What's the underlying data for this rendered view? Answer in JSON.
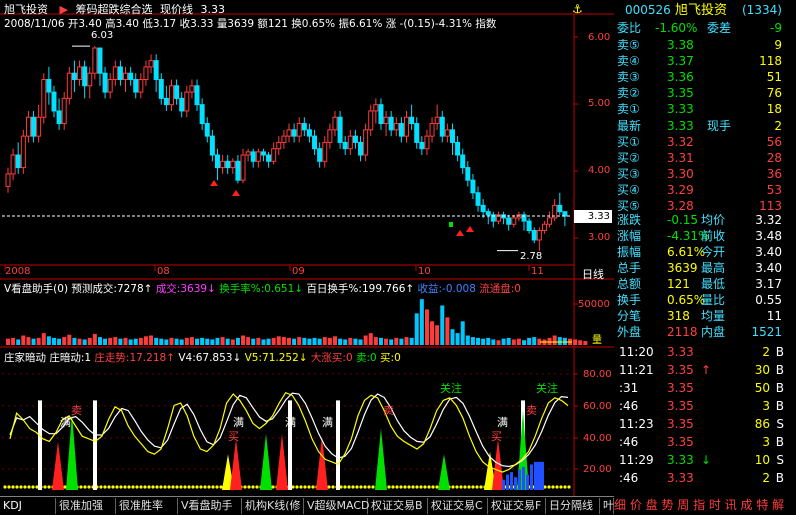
{
  "chart_header": {
    "title": "旭飞投资",
    "indicator": "筹码超跌综合选",
    "price_label": "现价线",
    "price_value": "3.33",
    "info_date": "2008/11/06",
    "info_open": "开3.40",
    "info_high": "高3.40",
    "info_low": "低3.17",
    "info_close": "收3.33",
    "info_vol": "量3639",
    "info_amount": "额121",
    "info_turnover": "换0.65%",
    "info_amp": "振6.61%",
    "info_chg": "涨 -(0.15)-4.31%",
    "info_mode": "指数"
  },
  "price_axis": [
    "6.00",
    "5.00",
    "4.00",
    "3.00"
  ],
  "price_marks": {
    "high_label": "6.03",
    "low_label": "2.78",
    "current_tag": "3.33"
  },
  "time_axis": [
    "2008",
    "08",
    "09",
    "10",
    "11"
  ],
  "time_axis_mode": "日线",
  "volume_header": {
    "name": "V看盘助手(0)",
    "predict": "预测成交:7278↑",
    "turnover_label": "成交:3639↓",
    "rate_label": "换手率%:0.651↓",
    "hundred_day": "百日换手%:199.766↑",
    "income": "收益:-0.008",
    "float": "流通盘:0"
  },
  "volume_axis": [
    "50000"
  ],
  "volume_axis_label": "量",
  "indicator_header": {
    "name": "庄家暗动",
    "f1": "庄暗动:1",
    "f2": "庄走势:17.218↑",
    "f3": "V4:67.853↓",
    "f4": "V5:71.252↓",
    "f5": "大涨买:0",
    "f6": "卖:0",
    "f7": "买:0"
  },
  "indicator_axis": [
    "80.00",
    "60.00",
    "40.00",
    "20.00"
  ],
  "indicator_labels": {
    "focus1": "关注",
    "focus2": "关注",
    "full": "满",
    "buy": "买",
    "sell": "卖"
  },
  "colors": {
    "up": "#ff3c3c",
    "down": "#00e0ff",
    "grid": "#900000",
    "bg": "#000000",
    "axis": "#c00000"
  },
  "chart_data": {
    "type": "candlestick",
    "price_ylim": [
      2.6,
      6.35
    ],
    "candles": [
      [
        3.8,
        4.0,
        4.1,
        3.7
      ],
      [
        4.0,
        4.3,
        4.4,
        3.9
      ],
      [
        4.3,
        4.1,
        4.5,
        4.0
      ],
      [
        4.1,
        4.6,
        4.7,
        4.0
      ],
      [
        4.6,
        4.9,
        5.0,
        4.5
      ],
      [
        4.9,
        4.6,
        5.0,
        4.5
      ],
      [
        4.6,
        4.9,
        5.1,
        4.5
      ],
      [
        4.9,
        5.5,
        5.6,
        4.8
      ],
      [
        5.5,
        5.3,
        5.7,
        5.1
      ],
      [
        5.3,
        5.0,
        5.4,
        4.9
      ],
      [
        5.0,
        4.8,
        5.2,
        4.7
      ],
      [
        4.8,
        5.2,
        5.3,
        4.7
      ],
      [
        5.2,
        5.6,
        5.7,
        5.1
      ],
      [
        5.6,
        5.5,
        5.8,
        5.3
      ],
      [
        5.5,
        5.7,
        5.8,
        5.4
      ],
      [
        5.7,
        5.4,
        5.8,
        5.2
      ],
      [
        5.4,
        5.6,
        5.7,
        5.2
      ],
      [
        5.6,
        6.0,
        6.03,
        5.5
      ],
      [
        6.0,
        5.6,
        6.0,
        5.4
      ],
      [
        5.6,
        5.3,
        5.7,
        5.2
      ],
      [
        5.3,
        5.5,
        5.6,
        5.2
      ],
      [
        5.5,
        5.7,
        5.8,
        5.4
      ],
      [
        5.7,
        5.5,
        5.8,
        5.4
      ],
      [
        5.5,
        5.6,
        5.7,
        5.3
      ],
      [
        5.6,
        5.5,
        5.7,
        5.4
      ],
      [
        5.5,
        5.3,
        5.6,
        5.2
      ],
      [
        5.3,
        5.5,
        5.6,
        5.2
      ],
      [
        5.5,
        5.7,
        5.8,
        5.4
      ],
      [
        5.7,
        5.8,
        5.9,
        5.6
      ],
      [
        5.8,
        5.5,
        5.9,
        5.3
      ],
      [
        5.5,
        5.2,
        5.6,
        5.1
      ],
      [
        5.2,
        5.1,
        5.4,
        5.0
      ],
      [
        5.1,
        5.4,
        5.5,
        5.0
      ],
      [
        5.4,
        5.2,
        5.5,
        5.1
      ],
      [
        5.2,
        5.0,
        5.3,
        4.9
      ],
      [
        5.0,
        5.3,
        5.4,
        4.9
      ],
      [
        5.3,
        5.4,
        5.5,
        5.2
      ],
      [
        5.4,
        5.1,
        5.5,
        5.0
      ],
      [
        5.1,
        4.8,
        5.2,
        4.7
      ],
      [
        4.8,
        4.6,
        4.9,
        4.5
      ],
      [
        4.6,
        4.3,
        4.7,
        4.2
      ],
      [
        4.3,
        4.1,
        4.4,
        3.9
      ],
      [
        4.1,
        4.2,
        4.3,
        4.0
      ],
      [
        4.2,
        4.1,
        4.3,
        4.0
      ],
      [
        4.1,
        4.2,
        4.25,
        4.0
      ],
      [
        4.2,
        3.9,
        4.3,
        3.85
      ],
      [
        3.9,
        4.3,
        4.4,
        3.85
      ],
      [
        4.3,
        4.35,
        4.4,
        4.2
      ],
      [
        4.35,
        4.2,
        4.4,
        4.1
      ],
      [
        4.2,
        4.35,
        4.4,
        4.1
      ],
      [
        4.35,
        4.3,
        4.4,
        4.2
      ],
      [
        4.3,
        4.2,
        4.35,
        4.1
      ],
      [
        4.2,
        4.4,
        4.5,
        4.15
      ],
      [
        4.4,
        4.5,
        4.6,
        4.3
      ],
      [
        4.5,
        4.6,
        4.7,
        4.4
      ],
      [
        4.6,
        4.7,
        4.8,
        4.5
      ],
      [
        4.7,
        4.6,
        4.8,
        4.5
      ],
      [
        4.6,
        4.8,
        4.9,
        4.5
      ],
      [
        4.8,
        4.7,
        4.9,
        4.6
      ],
      [
        4.7,
        4.6,
        4.8,
        4.5
      ],
      [
        4.6,
        4.4,
        4.7,
        4.3
      ],
      [
        4.4,
        4.2,
        4.5,
        4.1
      ],
      [
        4.2,
        4.5,
        4.6,
        4.1
      ],
      [
        4.5,
        4.7,
        4.8,
        4.4
      ],
      [
        4.7,
        4.9,
        5.0,
        4.6
      ],
      [
        4.9,
        4.5,
        5.0,
        4.4
      ],
      [
        4.5,
        4.4,
        4.6,
        4.3
      ],
      [
        4.4,
        4.6,
        4.7,
        4.3
      ],
      [
        4.6,
        4.5,
        4.7,
        4.4
      ],
      [
        4.5,
        4.3,
        4.6,
        4.2
      ],
      [
        4.3,
        4.7,
        4.8,
        4.2
      ],
      [
        4.7,
        5.0,
        5.1,
        4.6
      ],
      [
        5.0,
        5.1,
        5.2,
        4.8
      ],
      [
        5.1,
        4.8,
        5.2,
        4.7
      ],
      [
        4.8,
        4.9,
        5.0,
        4.6
      ],
      [
        4.9,
        4.7,
        5.0,
        4.6
      ],
      [
        4.7,
        4.8,
        4.9,
        4.6
      ],
      [
        4.8,
        4.6,
        4.9,
        4.5
      ],
      [
        4.6,
        4.9,
        5.0,
        4.5
      ],
      [
        4.9,
        4.8,
        5.1,
        4.7
      ],
      [
        4.8,
        4.5,
        4.9,
        4.4
      ],
      [
        4.5,
        4.4,
        4.6,
        4.3
      ],
      [
        4.4,
        4.6,
        4.7,
        4.3
      ],
      [
        4.6,
        4.8,
        4.9,
        4.5
      ],
      [
        4.8,
        4.9,
        5.1,
        4.7
      ],
      [
        4.9,
        4.6,
        5.0,
        4.5
      ],
      [
        4.6,
        4.7,
        4.8,
        4.5
      ],
      [
        4.7,
        4.5,
        4.8,
        4.3
      ],
      [
        4.5,
        4.3,
        4.6,
        4.2
      ],
      [
        4.3,
        4.1,
        4.4,
        4.0
      ],
      [
        4.1,
        3.9,
        4.2,
        3.8
      ],
      [
        3.9,
        3.7,
        4.0,
        3.6
      ],
      [
        3.7,
        3.5,
        3.8,
        3.4
      ],
      [
        3.5,
        3.4,
        3.6,
        3.3
      ],
      [
        3.4,
        3.35,
        3.45,
        3.2
      ],
      [
        3.35,
        3.25,
        3.4,
        3.15
      ],
      [
        3.25,
        3.35,
        3.4,
        3.2
      ],
      [
        3.35,
        3.3,
        3.4,
        3.2
      ],
      [
        3.3,
        3.2,
        3.35,
        3.1
      ],
      [
        3.2,
        3.3,
        3.35,
        3.15
      ],
      [
        3.3,
        3.35,
        3.4,
        3.25
      ],
      [
        3.35,
        3.25,
        3.4,
        3.1
      ],
      [
        3.25,
        3.1,
        3.3,
        3.05
      ],
      [
        3.1,
        2.95,
        3.15,
        2.9
      ],
      [
        2.95,
        3.1,
        3.15,
        2.78
      ],
      [
        3.1,
        3.2,
        3.25,
        3.05
      ],
      [
        3.2,
        3.3,
        3.4,
        3.15
      ],
      [
        3.3,
        3.5,
        3.6,
        3.25
      ],
      [
        3.5,
        3.4,
        3.7,
        3.35
      ],
      [
        3.4,
        3.33,
        3.4,
        3.17
      ]
    ],
    "volume_ylim": [
      0,
      62000
    ],
    "volumes": [
      8000,
      9000,
      7000,
      12000,
      10000,
      8000,
      9000,
      15000,
      11000,
      9000,
      8000,
      10000,
      13000,
      9000,
      8000,
      7000,
      9000,
      14000,
      10000,
      8000,
      9000,
      10000,
      8000,
      9000,
      7000,
      8000,
      9000,
      11000,
      12000,
      9000,
      8000,
      7000,
      9000,
      8000,
      7000,
      9000,
      10000,
      8000,
      9000,
      8000,
      7000,
      9000,
      10000,
      8000,
      7000,
      9000,
      12000,
      10000,
      8000,
      9000,
      7000,
      8000,
      9000,
      11000,
      10000,
      9000,
      8000,
      10000,
      9000,
      8000,
      9000,
      8000,
      10000,
      9000,
      11000,
      8000,
      7000,
      9000,
      8000,
      7000,
      12000,
      15000,
      10000,
      9000,
      8000,
      7000,
      9000,
      8000,
      10000,
      9000,
      40000,
      58000,
      45000,
      30000,
      25000,
      50000,
      35000,
      20000,
      15000,
      30000,
      12000,
      10000,
      9000,
      8000,
      9000,
      7000,
      6000,
      8000,
      9000,
      7000,
      8000,
      6000,
      9000,
      10000,
      8000,
      7000,
      9000,
      12000,
      10000,
      9000,
      8000,
      7000,
      6000,
      5000
    ],
    "indicator_ylim": [
      0,
      100
    ]
  },
  "quote_panel": {
    "code": "000526",
    "name": "旭飞投资",
    "number": "(1334)",
    "webi_label": "委比",
    "webi_value": "-1.60%",
    "weicha_label": "委差",
    "weicha_value": "-9",
    "sells": [
      {
        "label": "卖⑤",
        "price": "3.38",
        "vol": "9"
      },
      {
        "label": "卖④",
        "price": "3.37",
        "vol": "118"
      },
      {
        "label": "卖③",
        "price": "3.36",
        "vol": "51"
      },
      {
        "label": "卖②",
        "price": "3.35",
        "vol": "76"
      },
      {
        "label": "卖①",
        "price": "3.33",
        "vol": "18"
      }
    ],
    "last_label": "最新",
    "last_price": "3.33",
    "cur_hand_label": "现手",
    "cur_hand": "2",
    "buys": [
      {
        "label": "买①",
        "price": "3.32",
        "vol": "56"
      },
      {
        "label": "买②",
        "price": "3.31",
        "vol": "28"
      },
      {
        "label": "买③",
        "price": "3.30",
        "vol": "36"
      },
      {
        "label": "买④",
        "price": "3.29",
        "vol": "53"
      },
      {
        "label": "买⑤",
        "price": "3.28",
        "vol": "113"
      }
    ],
    "stats": [
      {
        "l1": "涨跌",
        "v1": "-0.15",
        "l2": "均价",
        "v2": "3.32"
      },
      {
        "l1": "涨幅",
        "v1": "-4.31%",
        "l2": "前收",
        "v2": "3.48"
      },
      {
        "l1": "振幅",
        "v1": "6.61%",
        "l2": "今开",
        "v2": "3.40"
      },
      {
        "l1": "总手",
        "v1": "3639",
        "l2": "最高",
        "v2": "3.40"
      },
      {
        "l1": "总额",
        "v1": "121",
        "l2": "最低",
        "v2": "3.17"
      },
      {
        "l1": "换手",
        "v1": "0.65%",
        "l2": "量比",
        "v2": "0.55"
      },
      {
        "l1": "分笔",
        "v1": "318",
        "l2": "均量",
        "v2": "11"
      }
    ],
    "outer_label": "外盘",
    "outer_value": "2118",
    "inner_label": "内盘",
    "inner_value": "1521",
    "ticks": [
      {
        "time": "11:20",
        "price": "3.33",
        "arrow": "",
        "vol": "2",
        "side": "B"
      },
      {
        "time": "11:21",
        "price": "3.35",
        "arrow": "↑",
        "vol": "30",
        "side": "B"
      },
      {
        "time": ":31",
        "price": "3.35",
        "arrow": "",
        "vol": "50",
        "side": "B"
      },
      {
        "time": ":46",
        "price": "3.35",
        "arrow": "",
        "vol": "3",
        "side": "B"
      },
      {
        "time": "11:23",
        "price": "3.35",
        "arrow": "",
        "vol": "86",
        "side": "S"
      },
      {
        "time": ":46",
        "price": "3.35",
        "arrow": "",
        "vol": "3",
        "side": "B"
      },
      {
        "time": "11:29",
        "price": "3.33",
        "arrow": "↓",
        "vol": "10",
        "side": "S"
      },
      {
        "time": ":46",
        "price": "3.33",
        "arrow": "",
        "vol": "2",
        "side": "B"
      }
    ]
  },
  "bottom_tabs": [
    "KDJ",
    "很准加强",
    "很准胜率",
    "V看盘助手",
    "机构K线(修",
    "V超级MACD",
    "权证交易B",
    "权证交易C",
    "权证交易F",
    "日分隔线",
    "叶"
  ],
  "footer_text": "细 价 盘 势 周 指 时 讯 成 特 解"
}
